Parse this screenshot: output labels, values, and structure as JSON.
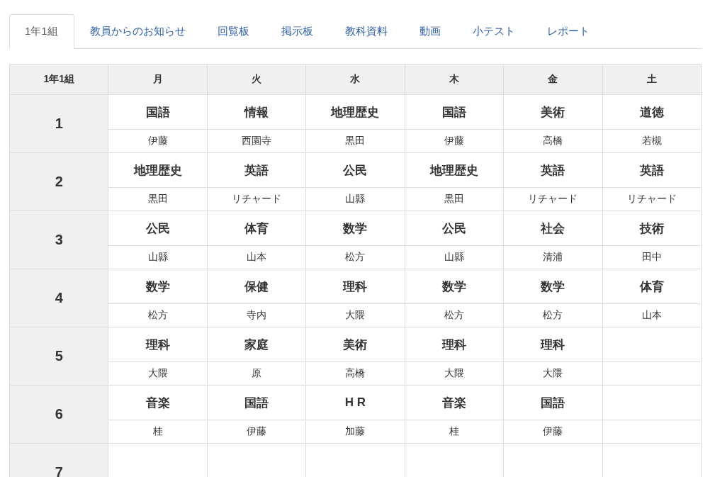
{
  "tabs": [
    {
      "label": "1年1組",
      "selected": true
    },
    {
      "label": "教員からのお知らせ",
      "selected": false
    },
    {
      "label": "回覧板",
      "selected": false
    },
    {
      "label": "掲示板",
      "selected": false
    },
    {
      "label": "教科資料",
      "selected": false
    },
    {
      "label": "動画",
      "selected": false
    },
    {
      "label": "小テスト",
      "selected": false
    },
    {
      "label": "レポート",
      "selected": false
    }
  ],
  "timetable": {
    "corner": "1年1組",
    "days": [
      "月",
      "火",
      "水",
      "木",
      "金",
      "土"
    ],
    "periods": [
      {
        "number": "1",
        "lessons": [
          {
            "subject": "国語",
            "teacher": "伊藤"
          },
          {
            "subject": "情報",
            "teacher": "西園寺"
          },
          {
            "subject": "地理歴史",
            "teacher": "黒田"
          },
          {
            "subject": "国語",
            "teacher": "伊藤"
          },
          {
            "subject": "美術",
            "teacher": "高橋"
          },
          {
            "subject": "道徳",
            "teacher": "若槻"
          }
        ]
      },
      {
        "number": "2",
        "lessons": [
          {
            "subject": "地理歴史",
            "teacher": "黒田"
          },
          {
            "subject": "英語",
            "teacher": "リチャード"
          },
          {
            "subject": "公民",
            "teacher": "山縣"
          },
          {
            "subject": "地理歴史",
            "teacher": "黒田"
          },
          {
            "subject": "英語",
            "teacher": "リチャード"
          },
          {
            "subject": "英語",
            "teacher": "リチャード"
          }
        ]
      },
      {
        "number": "3",
        "lessons": [
          {
            "subject": "公民",
            "teacher": "山縣"
          },
          {
            "subject": "体育",
            "teacher": "山本"
          },
          {
            "subject": "数学",
            "teacher": "松方"
          },
          {
            "subject": "公民",
            "teacher": "山縣"
          },
          {
            "subject": "社会",
            "teacher": "清浦"
          },
          {
            "subject": "技術",
            "teacher": "田中"
          }
        ]
      },
      {
        "number": "4",
        "lessons": [
          {
            "subject": "数学",
            "teacher": "松方"
          },
          {
            "subject": "保健",
            "teacher": "寺内"
          },
          {
            "subject": "理科",
            "teacher": "大隈"
          },
          {
            "subject": "数学",
            "teacher": "松方"
          },
          {
            "subject": "数学",
            "teacher": "松方"
          },
          {
            "subject": "体育",
            "teacher": "山本"
          }
        ]
      },
      {
        "number": "5",
        "lessons": [
          {
            "subject": "理科",
            "teacher": "大隈"
          },
          {
            "subject": "家庭",
            "teacher": "原"
          },
          {
            "subject": "美術",
            "teacher": "高橋"
          },
          {
            "subject": "理科",
            "teacher": "大隈"
          },
          {
            "subject": "理科",
            "teacher": "大隈"
          }
        ]
      },
      {
        "number": "6",
        "lessons": [
          {
            "subject": "音楽",
            "teacher": "桂"
          },
          {
            "subject": "国語",
            "teacher": "伊藤"
          },
          {
            "subject": "H R",
            "teacher": "加藤"
          },
          {
            "subject": "音楽",
            "teacher": "桂"
          },
          {
            "subject": "国語",
            "teacher": "伊藤"
          }
        ]
      },
      {
        "number": "7"
      }
    ]
  }
}
